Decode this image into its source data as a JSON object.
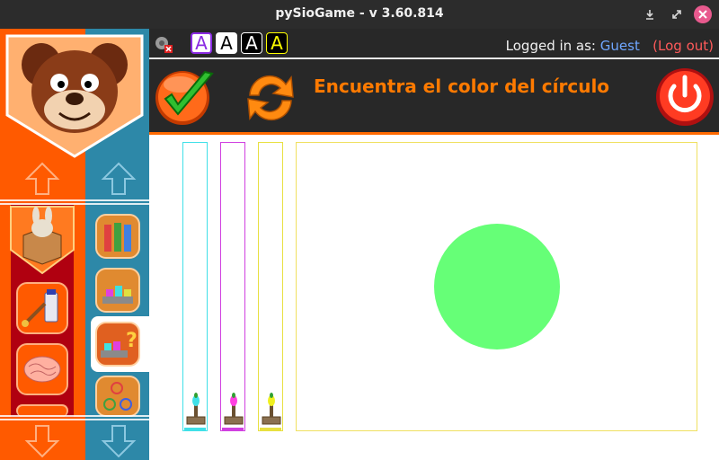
{
  "window": {
    "title": "pySioGame - v 3.60.814",
    "controls": [
      "minimize",
      "maximize",
      "close"
    ]
  },
  "infobar": {
    "font_buttons": [
      "A",
      "A",
      "A",
      "A"
    ],
    "login_prefix": "Logged in as:",
    "user": "Guest",
    "logout": "(Log out)"
  },
  "toolbar": {
    "task": "Encuentra el color del círculo"
  },
  "colors": {
    "titlebar": "#2c2c2c",
    "dark": "#282828",
    "accent_orange": "#ff6a00",
    "sidebar_orange": "#ff5a00",
    "sidebar_blue": "#2d88a8",
    "sidebar_red": "#b00010",
    "tube_cyan": "#40e0e8",
    "tube_magenta": "#d040e0",
    "tube_yellow": "#e8e040",
    "target_circle": "#66ff77"
  },
  "icons": {
    "check": "check-icon",
    "refresh": "refresh-icon",
    "power": "power-icon"
  }
}
